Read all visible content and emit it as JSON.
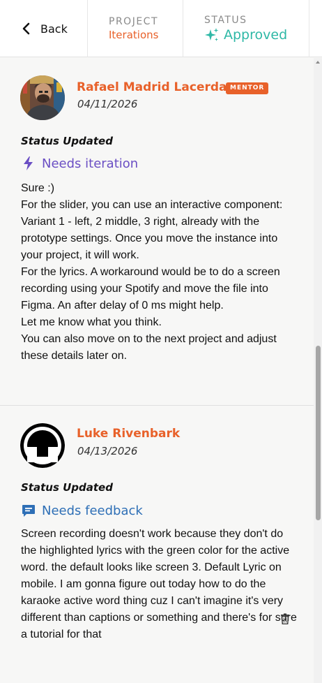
{
  "header": {
    "back_label": "Back",
    "project_label": "PROJECT",
    "project_value": "Iterations",
    "status_label": "STATUS",
    "status_value": "Approved",
    "status_icon": "sparkle-icon",
    "accent_color": "#e8612a",
    "status_color": "#2eb8a6"
  },
  "feed": [
    {
      "author": "Rafael Madrid Lacerda",
      "badge": "MENTOR",
      "date": "04/11/2026",
      "update_title": "Status Updated",
      "state": "Needs iteration",
      "state_icon": "lightning-icon",
      "state_color": "#6b4fc4",
      "message": [
        "Sure :)",
        "For the slider, you can use an interactive component:",
        "Variant 1 - left, 2 middle, 3 right, already with the prototype settings. Once you move the instance into your project, it will work.",
        "For the lyrics. A workaround would be to do a screen recording using your Spotify and move the file into Figma. An after delay of 0 ms might help.",
        "Let me know what you think.",
        "You can also move on to the next project and adjust these details later on."
      ]
    },
    {
      "author": "Luke Rivenbark",
      "date": "04/13/2026",
      "update_title": "Status Updated",
      "state": "Needs feedback",
      "state_icon": "comment-icon",
      "state_color": "#2e6fb6",
      "message": [
        "Screen recording doesn't work because they don't do the highlighted lyrics with the green color for the active word. the default looks like screen 3. Default Lyric on mobile. I am gonna figure out today how to do the karaoke active word thing cuz I can't imagine it's very different than captions or something and there's for sure a tutorial for that"
      ]
    }
  ]
}
